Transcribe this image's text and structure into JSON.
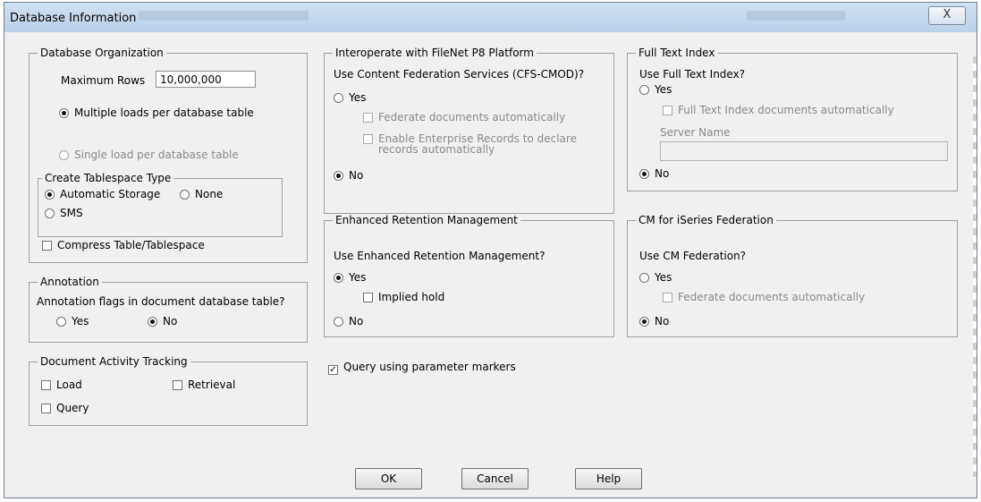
{
  "window": {
    "title": "Database Information",
    "close_label": "X"
  },
  "db_org": {
    "legend": "Database Organization",
    "max_rows_label": "Maximum Rows",
    "max_rows_value": "10,000,000",
    "multiple_label": "Multiple loads per database table",
    "single_label": "Single load per database table",
    "tablespace": {
      "legend": "Create Tablespace Type",
      "auto_label": "Automatic Storage",
      "none_label": "None",
      "sms_label": "SMS"
    },
    "compress_label": "Compress Table/Tablespace"
  },
  "annotation": {
    "legend": "Annotation",
    "question": "Annotation flags in document database table?",
    "yes": "Yes",
    "no": "No"
  },
  "tracking": {
    "legend": "Document Activity Tracking",
    "load": "Load",
    "retrieval": "Retrieval",
    "query": "Query"
  },
  "filenet": {
    "legend": "Interoperate with FileNet P8 Platform",
    "question": "Use Content Federation Services (CFS-CMOD)?",
    "yes": "Yes",
    "federate": "Federate documents automatically",
    "enable_line1": "Enable Enterprise Records to declare",
    "enable_line2": "records automatically",
    "no": "No"
  },
  "fulltext": {
    "legend": "Full Text Index",
    "question": "Use Full Text Index?",
    "yes": "Yes",
    "auto": "Full Text Index documents automatically",
    "server_label": "Server Name",
    "server_value": "",
    "no": "No"
  },
  "retention": {
    "legend": "Enhanced Retention Management",
    "question": "Use Enhanced Retention Management?",
    "yes": "Yes",
    "implied": "Implied hold",
    "no": "No"
  },
  "cm": {
    "legend": "CM for iSeries Federation",
    "question": "Use CM Federation?",
    "yes": "Yes",
    "federate": "Federate documents automatically",
    "no": "No"
  },
  "query_markers": {
    "label": "Query using parameter markers",
    "checked": true
  },
  "buttons": {
    "ok": "OK",
    "cancel": "Cancel",
    "help": "Help"
  }
}
